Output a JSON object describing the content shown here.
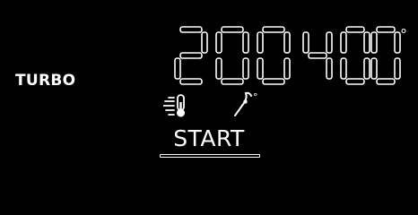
{
  "mode": {
    "label": "TURBO"
  },
  "display": {
    "time": "200",
    "temperature": "400",
    "unit": "°"
  },
  "icons": {
    "fan_thermometer": "fan-thermometer-icon",
    "probe": "meat-probe-icon"
  },
  "action": {
    "start_label": "START"
  },
  "colors": {
    "background": "#000000",
    "foreground": "#ffffff"
  }
}
